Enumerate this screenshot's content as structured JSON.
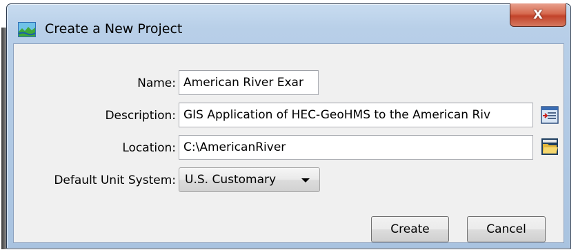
{
  "window": {
    "title": "Create a New Project",
    "close_glyph": "X"
  },
  "form": {
    "name": {
      "label": "Name:",
      "value": "American River Exar"
    },
    "description": {
      "label": "Description:",
      "value": "GIS Application of HEC-GeoHMS to the American Riv"
    },
    "location": {
      "label": "Location:",
      "value": "C:\\AmericanRiver"
    },
    "unit_system": {
      "label": "Default Unit System:",
      "selected": "U.S. Customary"
    }
  },
  "buttons": {
    "create": "Create",
    "cancel": "Cancel"
  },
  "icons": {
    "app": "hec-hms-app-icon",
    "description_editor": "text-editor-icon",
    "browse_folder": "open-folder-icon"
  },
  "colors": {
    "frame": "#b8cfe8",
    "close_button": "#c7462d",
    "content_bg": "#f0f0f0"
  }
}
